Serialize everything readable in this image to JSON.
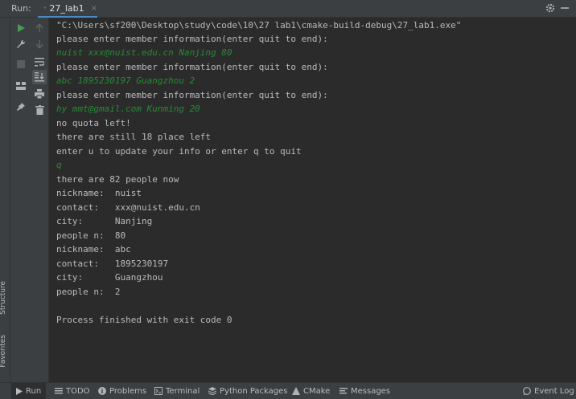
{
  "header": {
    "run_label": "Run:",
    "tab": {
      "label": "27_lab1"
    }
  },
  "left_strip": {
    "structure_label": "Structure",
    "favorites_label": "Favorites"
  },
  "console": {
    "lines": [
      {
        "text": "\"C:\\Users\\sf200\\Desktop\\study\\code\\10\\27 lab1\\cmake-build-debug\\27_lab1.exe\"",
        "kind": "cmd"
      },
      {
        "text": "please enter member information(enter quit to end):",
        "kind": "output"
      },
      {
        "text": "nuist xxx@nuist.edu.cn Nanjing 80",
        "kind": "input"
      },
      {
        "text": "please enter member information(enter quit to end):",
        "kind": "output"
      },
      {
        "text": "abc 1895230197 Guangzhou 2",
        "kind": "input"
      },
      {
        "text": "please enter member information(enter quit to end):",
        "kind": "output"
      },
      {
        "text": "hy mmt@gmail.com Kunming 20",
        "kind": "input"
      },
      {
        "text": "no quota left!",
        "kind": "output"
      },
      {
        "text": "there are still 18 place left",
        "kind": "output"
      },
      {
        "text": "enter u to update your info or enter q to quit",
        "kind": "output"
      },
      {
        "text": "q",
        "kind": "input"
      },
      {
        "text": "there are 82 people now",
        "kind": "output"
      },
      {
        "text": "nickname:  nuist",
        "kind": "output"
      },
      {
        "text": "contact:   xxx@nuist.edu.cn",
        "kind": "output"
      },
      {
        "text": "city:      Nanjing",
        "kind": "output"
      },
      {
        "text": "people n:  80",
        "kind": "output"
      },
      {
        "text": "nickname:  abc",
        "kind": "output"
      },
      {
        "text": "contact:   1895230197",
        "kind": "output"
      },
      {
        "text": "city:      Guangzhou",
        "kind": "output"
      },
      {
        "text": "people n:  2",
        "kind": "output"
      },
      {
        "text": "",
        "kind": "output"
      },
      {
        "text": "Process finished with exit code 0",
        "kind": "output"
      }
    ]
  },
  "bottom_tabs": {
    "run": "Run",
    "todo": "TODO",
    "problems": "Problems",
    "terminal": "Terminal",
    "python_packages": "Python Packages",
    "cmake": "CMake",
    "messages": "Messages",
    "event_log": "Event Log"
  },
  "colors": {
    "background": "#2b2b2b",
    "panel": "#3c3f41",
    "text": "#bbbbbb",
    "input_text": "#278a36",
    "accent": "#4a88c7",
    "run_green": "#499c54"
  }
}
